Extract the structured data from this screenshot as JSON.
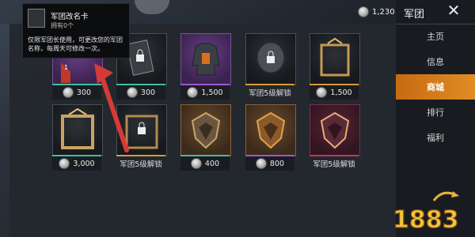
{
  "header": {
    "currency_amount": "1,230"
  },
  "sidebar": {
    "title": "军团",
    "items": [
      {
        "label": "主页",
        "active": false
      },
      {
        "label": "信息",
        "active": false
      },
      {
        "label": "商城",
        "active": true
      },
      {
        "label": "排行",
        "active": false
      },
      {
        "label": "福利",
        "active": false
      }
    ]
  },
  "tooltip": {
    "title": "军团改名卡",
    "subtitle": "拥有0个",
    "description": "仅限军团长使用，可更改您的军团名称，每周天可修改一次。"
  },
  "shop": {
    "items": [
      {
        "price": "300",
        "lock_text": ""
      },
      {
        "price": "300",
        "lock_text": ""
      },
      {
        "price": "1,500",
        "lock_text": ""
      },
      {
        "price": "",
        "lock_text": "军团5级解锁"
      },
      {
        "price": "1,500",
        "lock_text": ""
      },
      {
        "price": "3,000",
        "lock_text": ""
      },
      {
        "price": "",
        "lock_text": "军团5级解锁"
      },
      {
        "price": "400",
        "lock_text": ""
      },
      {
        "price": "800",
        "lock_text": ""
      },
      {
        "price": "",
        "lock_text": "军团5级解锁"
      }
    ]
  },
  "watermark": {
    "logo_text": "1883"
  },
  "colors": {
    "accent": "#e08d25",
    "teal": "#3fbfa3",
    "purple": "#9b59d0",
    "gold": "#d79a3c",
    "crimson": "#c0395c",
    "arrow": "#d63a36"
  }
}
